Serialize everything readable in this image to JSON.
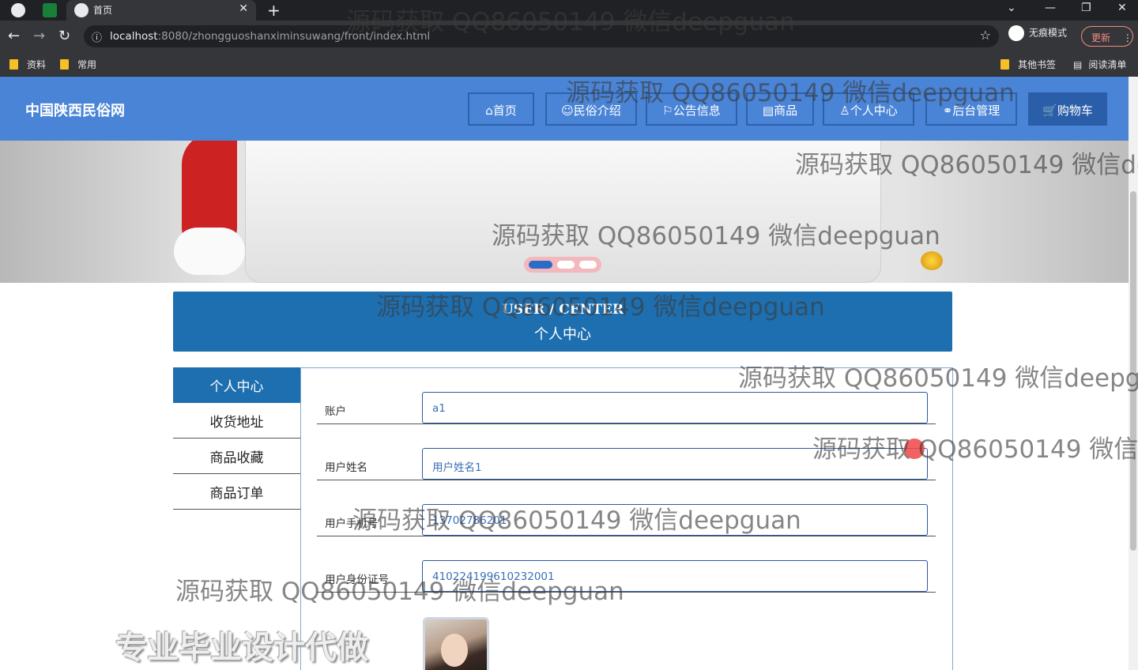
{
  "browser": {
    "tab_title": "首页",
    "url_host": "localhost",
    "url_path": ":8080/zhongguoshanximinsuwang/front/index.html",
    "incognito_label": "无痕模式",
    "update_label": "更新",
    "bookmarks": [
      "资料",
      "常用"
    ],
    "bookmarks_right": [
      "其他书签",
      "阅读清单"
    ]
  },
  "site": {
    "logo": "中国陕西民俗网",
    "nav": [
      "⌂首页",
      "☺民俗介绍",
      "⚐公告信息",
      "▤商品",
      "♙个人中心",
      "⚭后台管理",
      "🛒购物车"
    ]
  },
  "user_center": {
    "title_en": "USER / CENTER",
    "title_cn": "个人中心"
  },
  "sidebar": {
    "items": [
      "个人中心",
      "收货地址",
      "商品收藏",
      "商品订单"
    ]
  },
  "form": {
    "fields": [
      {
        "label": "账户",
        "value": "a1"
      },
      {
        "label": "用户姓名",
        "value": "用户姓名1"
      },
      {
        "label": "用户手机号",
        "value": "13702786201"
      },
      {
        "label": "用户身份证号",
        "value": "410224199610232001"
      }
    ]
  },
  "watermarks": {
    "text": "源码获取 QQ86050149 微信deepguan",
    "ad": "专业毕业设计代做"
  }
}
